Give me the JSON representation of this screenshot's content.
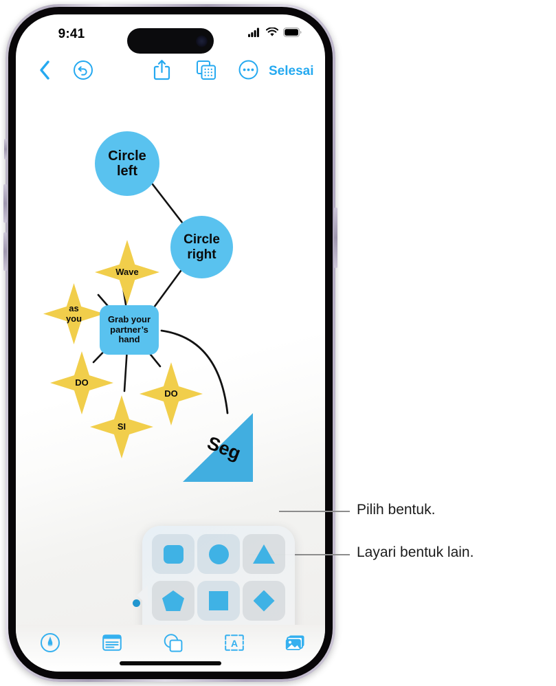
{
  "status_bar": {
    "time": "9:41",
    "cellular_icon": "cellular-signal-icon",
    "wifi_icon": "wifi-icon",
    "battery_icon": "battery-icon"
  },
  "toolbar_top": {
    "back_icon": "chevron-left-icon",
    "undo_icon": "undo-icon",
    "share_icon": "share-icon",
    "pages_icon": "pages-icon",
    "more_icon": "more-circle-icon",
    "done_label": "Selesai"
  },
  "canvas": {
    "accent_blue": "#59c2ef",
    "accent_yellow": "#f1ce4b",
    "triangle_blue": "#41aee0",
    "nodes": [
      {
        "id": "circle-left",
        "label": "Circle\nleft",
        "label_lines": [
          "Circle",
          "left"
        ],
        "shape": "circle"
      },
      {
        "id": "circle-right",
        "label": "Circle\nright",
        "label_lines": [
          "Circle",
          "right"
        ],
        "shape": "circle"
      },
      {
        "id": "wave",
        "label": "Wave",
        "shape": "star"
      },
      {
        "id": "as-you",
        "label": "as you",
        "label_lines": [
          "as",
          "you"
        ],
        "shape": "star"
      },
      {
        "id": "grab-hand",
        "label": "Grab your partner's hand",
        "label_lines": [
          "Grab your",
          "partner's",
          "hand"
        ],
        "shape": "rounded-rect"
      },
      {
        "id": "do-left",
        "label": "DO",
        "shape": "star"
      },
      {
        "id": "do-right",
        "label": "DO",
        "shape": "star"
      },
      {
        "id": "si",
        "label": "SI",
        "shape": "star"
      },
      {
        "id": "seg-triangle",
        "label": "Seg",
        "shape": "triangle"
      }
    ]
  },
  "shape_popover": {
    "items": [
      {
        "id": "rounded-square",
        "icon": "rounded-square-shape-icon",
        "selected": true
      },
      {
        "id": "circle",
        "icon": "circle-shape-icon",
        "selected": true
      },
      {
        "id": "triangle",
        "icon": "triangle-shape-icon",
        "selected": false
      },
      {
        "id": "pentagon",
        "icon": "pentagon-shape-icon",
        "selected": false
      },
      {
        "id": "square",
        "icon": "square-shape-icon",
        "selected": true
      },
      {
        "id": "diamond",
        "icon": "diamond-shape-icon",
        "selected": false
      },
      {
        "id": "pill",
        "icon": "pill-shape-icon",
        "selected": false
      },
      {
        "id": "parallelogram",
        "icon": "parallelogram-shape-icon",
        "selected": false
      },
      {
        "id": "more",
        "icon": "ellipsis-icon",
        "selected": false
      }
    ]
  },
  "toolbar_bottom": {
    "items": [
      {
        "id": "markup",
        "icon": "pen-circle-icon"
      },
      {
        "id": "text",
        "icon": "text-box-icon"
      },
      {
        "id": "shapes",
        "icon": "shapes-icon"
      },
      {
        "id": "textbox",
        "icon": "text-a-box-icon"
      },
      {
        "id": "media",
        "icon": "media-icon"
      }
    ]
  },
  "callouts": [
    {
      "id": "callout-select-shape",
      "text": "Pilih bentuk."
    },
    {
      "id": "callout-browse-shapes",
      "text": "Layari bentuk lain."
    }
  ]
}
